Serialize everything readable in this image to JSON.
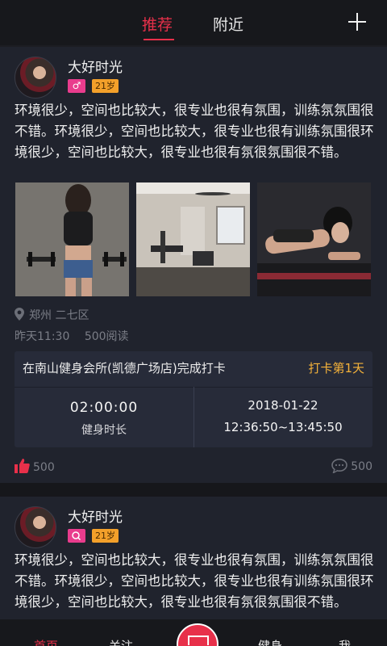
{
  "topbar": {
    "tabs": [
      {
        "label": "推荐",
        "active": true
      },
      {
        "label": "附近",
        "active": false
      }
    ],
    "add_icon": "plus-icon"
  },
  "posts": [
    {
      "username": "大好时光",
      "gender_icon": "male-icon",
      "gender_symbol": "♂",
      "age": "21岁",
      "text": "环境很少，空间也比较大，很专业也很有氛围，训练氛氛围很不错。环境很少，空间也比较大，很专业也很有训练氛围很环境很少，空间也比较大，很专业也很有氛很氛围很不错。",
      "photos": [
        "gym-woman-dumbbells-photo",
        "gym-equipment-room-photo",
        "woman-plank-exercise-photo"
      ],
      "location": "郑州  二七区",
      "time": "昨天11:30",
      "reads": "500阅读",
      "checkin": {
        "title": "在南山健身会所(凯德广场店)完成打卡",
        "day": "打卡第1天",
        "duration_value": "02:00:00",
        "duration_label": "健身时长",
        "date": "2018-01-22",
        "time_range": "12:36:50~13:45:50"
      },
      "likes": "500",
      "comments": "500"
    },
    {
      "username": "大好时光",
      "age": "21岁",
      "text": "环境很少，空间也比较大，很专业也很有氛围，训练氛氛围很不错。环境很少，空间也比较大，很专业也很有训练氛围很环境很少，空间也比较大，很专业也很有氛很氛围很不错。"
    }
  ],
  "bottombar": {
    "items": [
      {
        "label": "首页",
        "active": true
      },
      {
        "label": "关注"
      },
      {
        "label": "健身"
      },
      {
        "label": "我"
      }
    ]
  },
  "colors": {
    "accent": "#e8304a",
    "gender_badge": "#e93c8d",
    "age_badge": "#f3a02a",
    "checkin_day": "#f4b23a",
    "background": "#20232d"
  }
}
